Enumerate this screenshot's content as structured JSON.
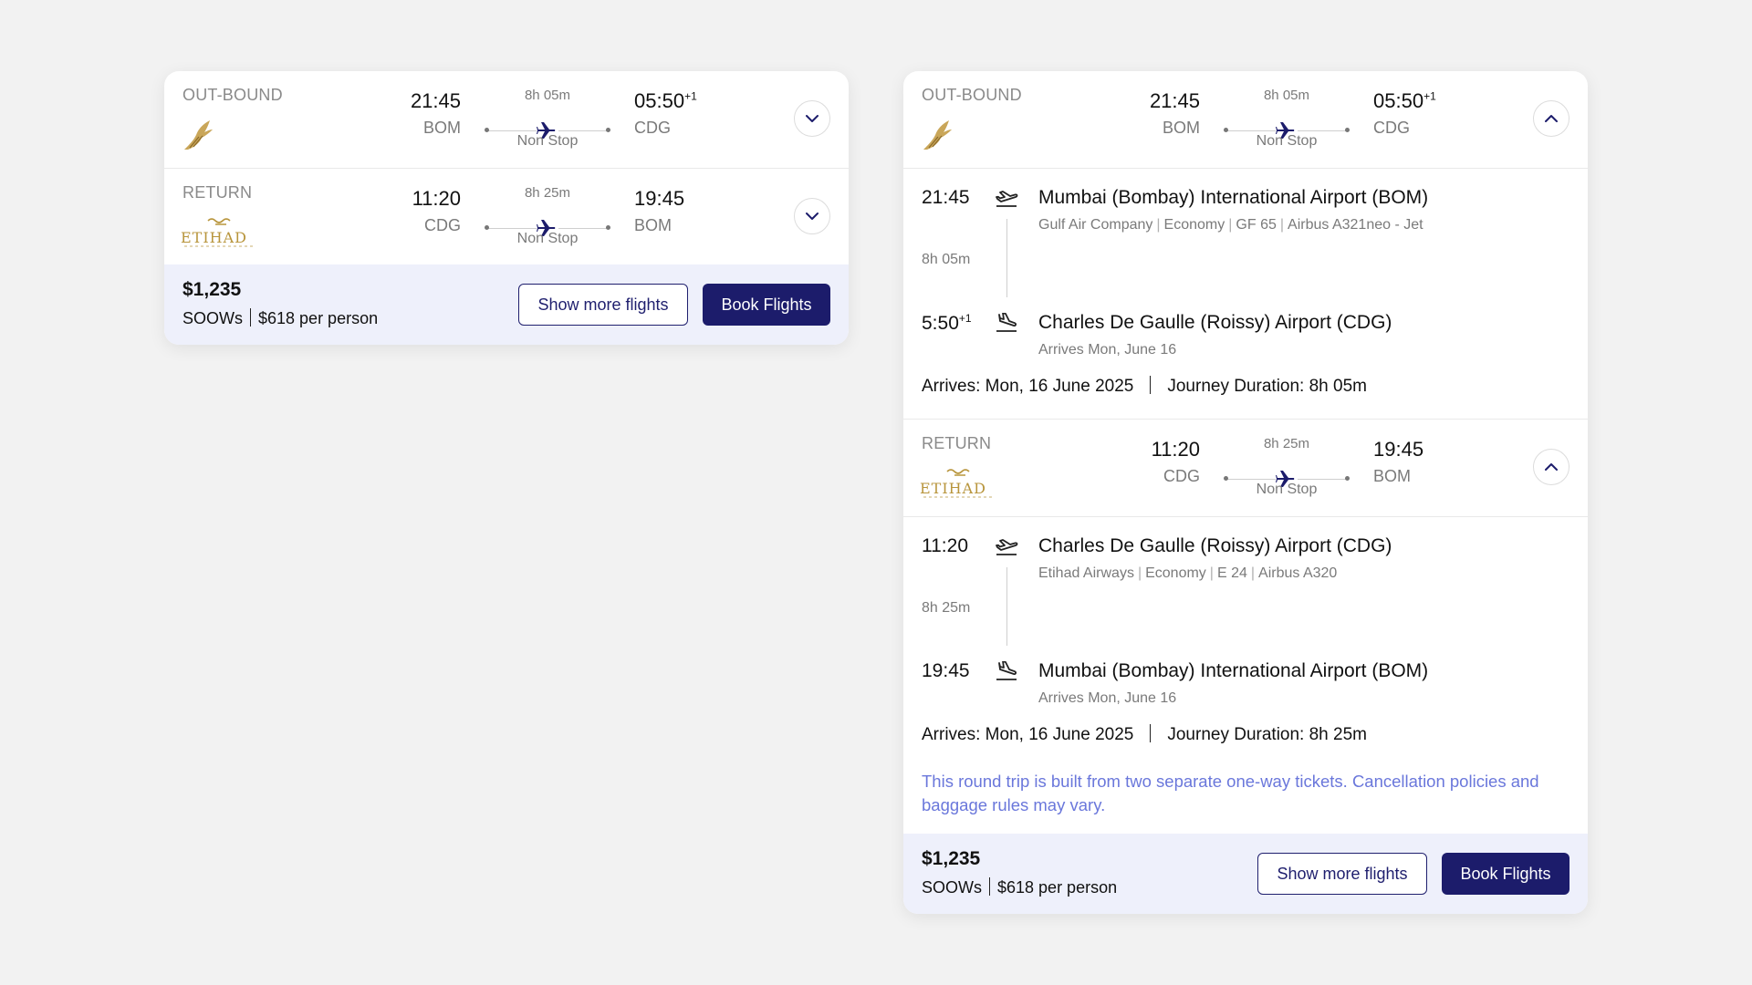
{
  "colors": {
    "background": "#f2f2f2",
    "navy": "#1c1c6b",
    "footer_bg": "#eef0fb",
    "notice_text": "#6a77db",
    "etihad_gold": "#b8953c"
  },
  "outbound": {
    "label": "OUT-BOUND",
    "airline_logo_icon": "gulf-air-falcon-icon",
    "dep_time": "21:45",
    "dep_code": "BOM",
    "duration": "8h 05m",
    "stops": "Non Stop",
    "arr_time": "05:50",
    "arr_offset": "+1",
    "arr_code": "CDG"
  },
  "return": {
    "label": "RETURN",
    "airline_logo_icon": "etihad-logo-icon",
    "dep_time": "11:20",
    "dep_code": "CDG",
    "duration": "8h 25m",
    "stops": "Non Stop",
    "arr_time": "19:45",
    "arr_offset": "",
    "arr_code": "BOM"
  },
  "outbound_detail": {
    "dep_time": "21:45",
    "dep_airport": "Mumbai (Bombay) International Airport (BOM)",
    "carrier": "Gulf Air Company",
    "cabin": "Economy",
    "flight_no": "GF 65",
    "aircraft": "Airbus A321neo - Jet",
    "duration": "8h 05m",
    "arr_time": "5:50",
    "arr_offset": "+1",
    "arr_airport": "Charles De Gaulle (Roissy) Airport (CDG)",
    "arr_note": "Arrives Mon, June 16",
    "arrives": "Arrives: Mon, 16 June 2025",
    "journey": "Journey Duration: 8h 05m"
  },
  "return_detail": {
    "dep_time": "11:20",
    "dep_airport": "Charles De Gaulle (Roissy) Airport (CDG)",
    "carrier": "Etihad Airways",
    "cabin": "Economy",
    "flight_no": "E 24",
    "aircraft": "Airbus A320",
    "duration": "8h 25m",
    "arr_time": "19:45",
    "arr_airport": "Mumbai (Bombay) International Airport (BOM)",
    "arr_note": "Arrives Mon, June 16",
    "arrives": "Arrives: Mon, 16 June 2025",
    "journey": "Journey Duration: 8h 25m"
  },
  "notice": "This round trip is built from two separate one-way tickets. Cancellation policies and baggage rules may vary.",
  "footer": {
    "price": "$1,235",
    "source": "SOOWs",
    "per_person": "$618 per person",
    "show_more_label": "Show more flights",
    "book_label": "Book Flights"
  },
  "icons": {
    "expand": "chevron-down-icon",
    "collapse": "chevron-up-icon",
    "plane": "airplane-icon",
    "takeoff": "takeoff-icon",
    "landing": "landing-icon"
  }
}
